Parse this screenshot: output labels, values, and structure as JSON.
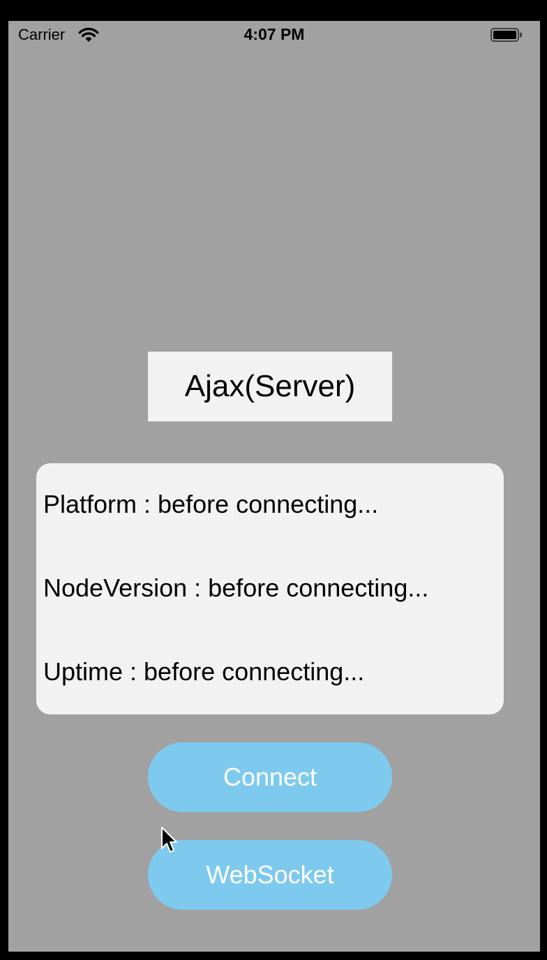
{
  "status_bar": {
    "carrier": "Carrier",
    "time": "4:07 PM",
    "wifi_icon": "wifi-icon",
    "battery_icon": "battery-icon"
  },
  "title": "Ajax(Server)",
  "info": {
    "platform": "Platform : before connecting...",
    "node_version": "NodeVersion : before connecting...",
    "uptime": "Uptime : before connecting..."
  },
  "buttons": {
    "connect": "Connect",
    "websocket": "WebSocket"
  },
  "colors": {
    "background": "#a1a1a1",
    "panel": "#f2f2f2",
    "button": "#7ecaee",
    "button_text": "#ffffff"
  }
}
